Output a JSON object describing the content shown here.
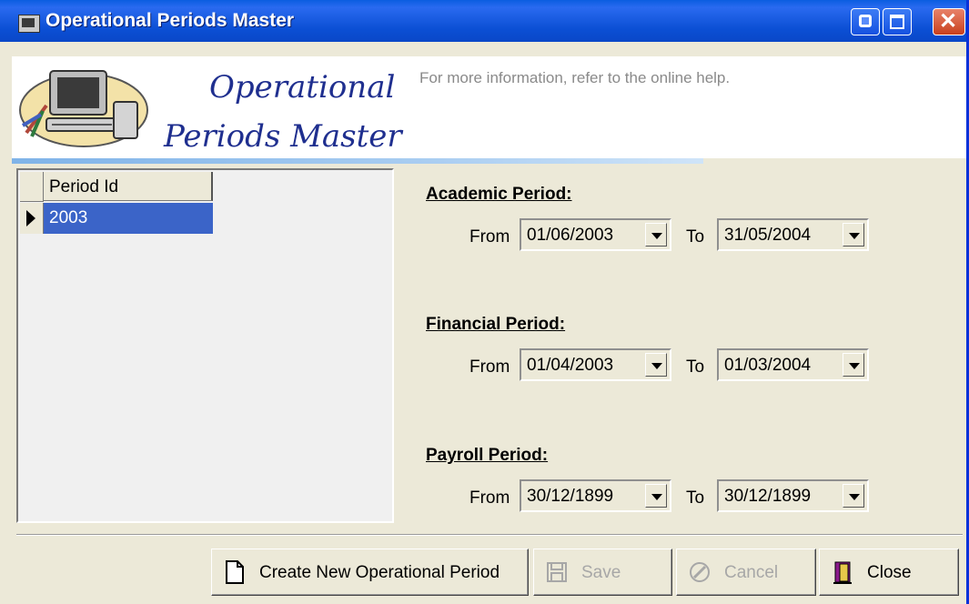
{
  "window": {
    "title": "Operational Periods Master"
  },
  "header": {
    "heading_line1": "Operational",
    "heading_line2": "Periods Master",
    "help_text": "For more information, refer to the online help."
  },
  "grid": {
    "column_header": "Period Id",
    "rows": [
      "2003"
    ]
  },
  "periods": {
    "academic": {
      "title": "Academic Period:",
      "from_label": "From",
      "from": "01/06/2003",
      "to_label": "To",
      "to": "31/05/2004"
    },
    "financial": {
      "title": "Financial Period:",
      "from_label": "From",
      "from": "01/04/2003",
      "to_label": "To",
      "to": "01/03/2004"
    },
    "payroll": {
      "title": "Payroll Period:",
      "from_label": "From",
      "from": "30/12/1899",
      "to_label": "To",
      "to": "30/12/1899"
    }
  },
  "buttons": {
    "create": "Create New Operational Period",
    "save": "Save",
    "cancel": "Cancel",
    "close": "Close"
  }
}
